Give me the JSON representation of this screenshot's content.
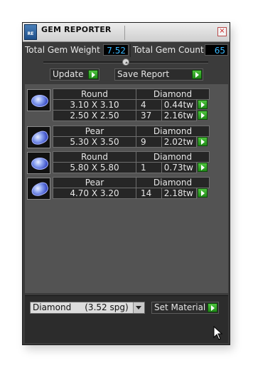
{
  "window": {
    "title": "GEM REPORTER",
    "app_icon_label": "RE"
  },
  "stats": {
    "weight_label": "Total Gem Weight",
    "weight_value": "7.52",
    "count_label": "Total Gem Count",
    "count_value": "65"
  },
  "toolbar": {
    "update_label": "Update",
    "save_label": "Save Report"
  },
  "gems": [
    {
      "cut": "Round",
      "material": "Diamond",
      "icon": "round-diamond-icon",
      "sizes": [
        {
          "dims": "3.10 X 3.10",
          "count": "4",
          "weight": "0.44tw"
        },
        {
          "dims": "2.50 X 2.50",
          "count": "37",
          "weight": "2.16tw"
        }
      ]
    },
    {
      "cut": "Pear",
      "material": "Diamond",
      "icon": "pear-diamond-icon",
      "sizes": [
        {
          "dims": "5.30 X 3.50",
          "count": "9",
          "weight": "2.02tw"
        }
      ]
    },
    {
      "cut": "Round",
      "material": "Diamond",
      "icon": "round-diamond-icon",
      "sizes": [
        {
          "dims": "5.80 X 5.80",
          "count": "1",
          "weight": "0.73tw"
        }
      ]
    },
    {
      "cut": "Pear",
      "material": "Diamond",
      "icon": "pear-diamond-icon",
      "sizes": [
        {
          "dims": "4.70 X 3.20",
          "count": "14",
          "weight": "2.18tw"
        }
      ]
    }
  ],
  "material_select": {
    "value": "Diamond     (3.52 spg)"
  },
  "set_material_label": "Set Material",
  "colors": {
    "accent_value": "#39b8ff",
    "go_green": "#3aa82c",
    "panel": "#3b3b3b"
  }
}
